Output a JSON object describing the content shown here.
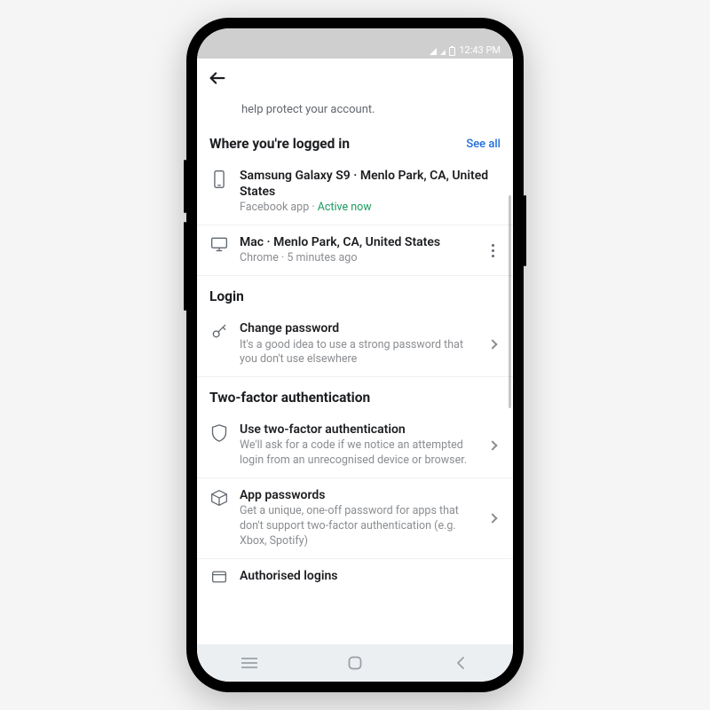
{
  "status": {
    "time": "12:43 PM"
  },
  "partial_prev_desc": "help protect your account.",
  "sections": {
    "logged_in": {
      "title": "Where you're logged in",
      "see_all": "See all",
      "items": [
        {
          "title": "Samsung Galaxy S9 · Menlo Park, CA, United States",
          "sub_prefix": "Facebook app · ",
          "sub_status": "Active now"
        },
        {
          "title": "Mac · Menlo Park, CA, United States",
          "sub": "Chrome · 5 minutes ago"
        }
      ]
    },
    "login": {
      "title": "Login",
      "change_pw": {
        "title": "Change password",
        "sub": "It's a good idea to use a strong password that you don't use elsewhere"
      }
    },
    "tfa": {
      "title": "Two-factor authentication",
      "use_tfa": {
        "title": "Use two-factor authentication",
        "sub": "We'll ask for a code if we notice an attempted login from an unrecognised device or browser."
      },
      "app_pw": {
        "title": "App passwords",
        "sub": "Get a unique, one-off password for apps that don't support two-factor authentication (e.g. Xbox, Spotify)"
      },
      "authorised": {
        "title": "Authorised logins"
      }
    }
  }
}
